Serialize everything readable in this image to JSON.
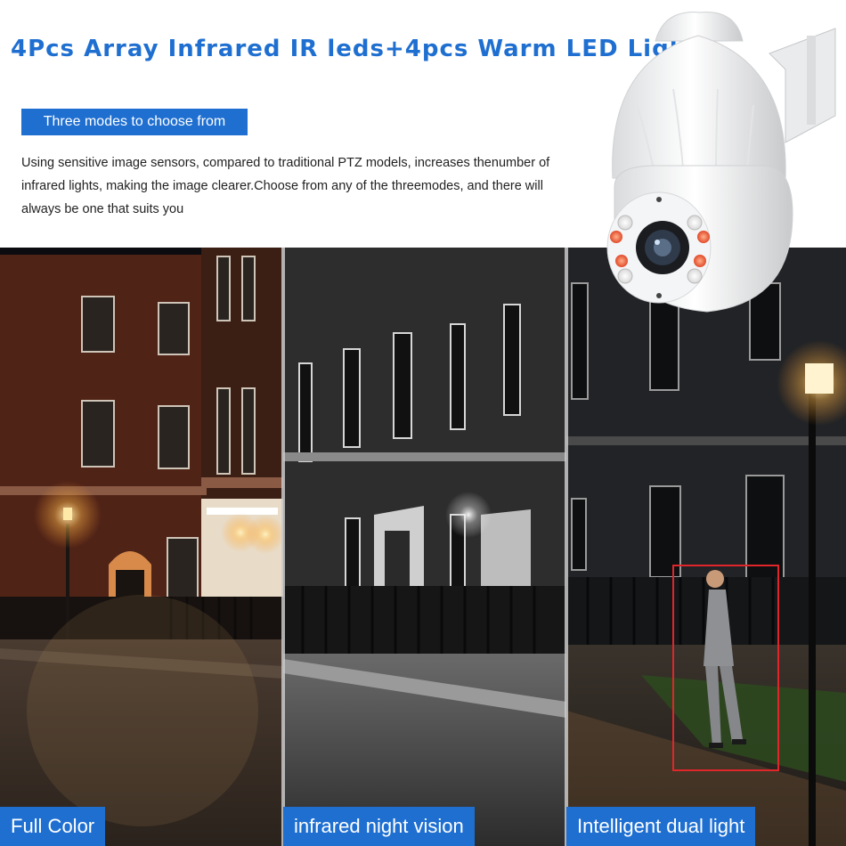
{
  "headline": "4Pcs Array Infrared IR leds+4pcs Warm LED Lights",
  "badge": "Three modes to choose from",
  "description": "Using sensitive image sensors, compared to traditional PTZ models, increases thenumber of infrared lights, making the image clearer.Choose from any of the threemodes, and there will always be one that suits you",
  "panels": [
    {
      "label": "Full Color"
    },
    {
      "label": "infrared night vision"
    },
    {
      "label": "Intelligent dual light"
    }
  ],
  "colors": {
    "accent": "#1f6fd1",
    "detection_box": "#e0262b"
  }
}
